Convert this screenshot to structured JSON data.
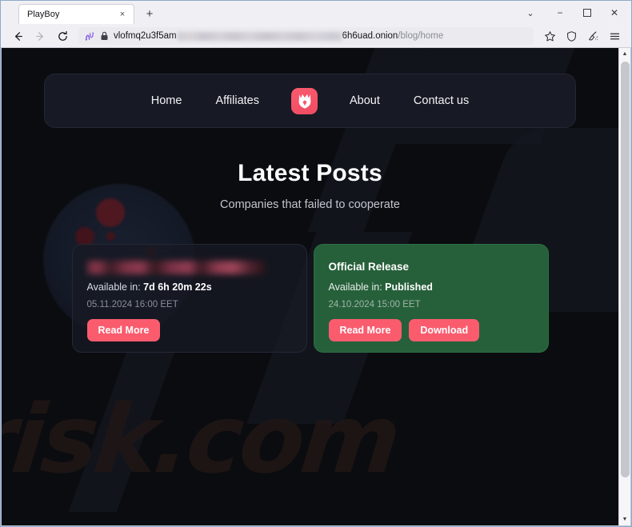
{
  "browser": {
    "tab": {
      "title": "PlayBoy",
      "close_label": "×"
    },
    "new_tab_label": "+",
    "window_controls": {
      "list_all_tabs": "⌄",
      "minimize": "−",
      "maximize": "☐",
      "close": "✕"
    },
    "nav": {
      "back": "back-arrow",
      "forward": "forward-arrow",
      "reload": "reload-arrow"
    },
    "urlbar": {
      "circuit_icon": "tor-circuit-icon",
      "lock_icon": "padlock-icon",
      "url_prefix": "vlofmq2u3f5am",
      "url_redacted": "",
      "url_host": "6h6uad.onion",
      "url_path": "/blog/home"
    },
    "toolbar_icons": {
      "bookmark": "star-icon",
      "shield": "shield-icon",
      "extension": "broom-icon",
      "menu": "hamburger-menu-icon"
    },
    "scrollbar": {
      "up": "▲",
      "down": "▼"
    }
  },
  "site": {
    "nav_links": [
      {
        "label": "Home"
      },
      {
        "label": "Affiliates"
      }
    ],
    "nav_links_right": [
      {
        "label": "About"
      },
      {
        "label": "Contact us"
      }
    ],
    "logo_name": "playboy-shield-logo",
    "hero": {
      "title": "Latest Posts",
      "subtitle": "Companies that failed to cooperate"
    },
    "watermark": "risk.com",
    "cards": [
      {
        "title": "",
        "title_redacted": true,
        "available_label": "Available in:",
        "available_value": "7d 6h 20m 22s",
        "date": "05.11.2024 16:00 EET",
        "buttons": [
          {
            "label": "Read More"
          }
        ],
        "variant": "dark"
      },
      {
        "title": "Official Release",
        "title_redacted": false,
        "available_label": "Available in:",
        "available_value": "Published",
        "date": "24.10.2024 15:00 EET",
        "buttons": [
          {
            "label": "Read More"
          },
          {
            "label": "Download"
          }
        ],
        "variant": "green"
      }
    ]
  },
  "colors": {
    "accent_pink": "#fa5c6e",
    "card_green": "#26603a",
    "page_bg": "#0b0c10",
    "nav_bg": "#171a24"
  }
}
